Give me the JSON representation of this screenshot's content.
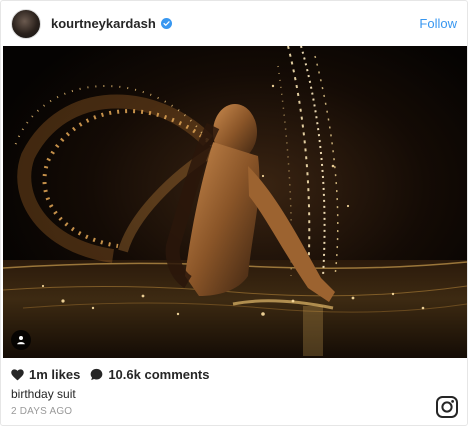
{
  "post": {
    "username": "kourtneykardash",
    "verified": true,
    "follow_label": "Follow",
    "likes": "1m likes",
    "comments": "10.6k comments",
    "caption": "birthday suit",
    "timestamp": "2 DAYS AGO"
  },
  "icons": {
    "verified": "verified-badge-icon",
    "user_tag": "user-tag-icon",
    "likes": "heart-icon",
    "comments": "speech-bubble-icon",
    "platform": "instagram-logo-icon"
  },
  "colors": {
    "accent": "#3897f0",
    "text": "#262626",
    "muted": "#999999"
  }
}
